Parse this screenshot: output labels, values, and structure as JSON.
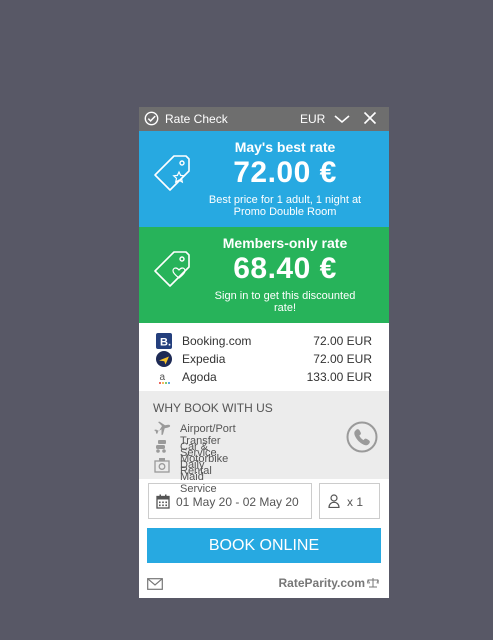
{
  "header": {
    "title": "Rate Check",
    "currency": "EUR"
  },
  "best_rate": {
    "label": "May's best rate",
    "price": "72.00 €",
    "sub_line1": "Best price for 1 adult, 1 night at",
    "sub_line2": "Promo Double Room"
  },
  "members_rate": {
    "label": "Members-only rate",
    "price": "68.40 €",
    "sub_line1": "Sign in to get this discounted",
    "sub_line2": "rate!"
  },
  "providers": [
    {
      "name": "Booking.com",
      "price": "72.00 EUR",
      "logo": "booking-logo"
    },
    {
      "name": "Expedia",
      "price": "72.00 EUR",
      "logo": "expedia-logo"
    },
    {
      "name": "Agoda",
      "price": "133.00 EUR",
      "logo": "agoda-logo"
    }
  ],
  "why": {
    "heading": "WHY BOOK WITH US",
    "items": [
      {
        "label": "Airport/Port Transfer Service",
        "icon": "plane-icon"
      },
      {
        "label": "Car & Motorbike Rental",
        "icon": "car-icon"
      },
      {
        "label": "Daily Maid Service",
        "icon": "maid-icon"
      }
    ]
  },
  "booking": {
    "dates": "01 May 20 - 02 May 20",
    "guests": "x 1",
    "button_label": "BOOK ONLINE"
  },
  "footer": {
    "brand": "RateParity.com"
  },
  "colors": {
    "blue": "#27a9e1",
    "green": "#27b35a",
    "topbar": "#6e6e6e",
    "background": "#585866"
  }
}
